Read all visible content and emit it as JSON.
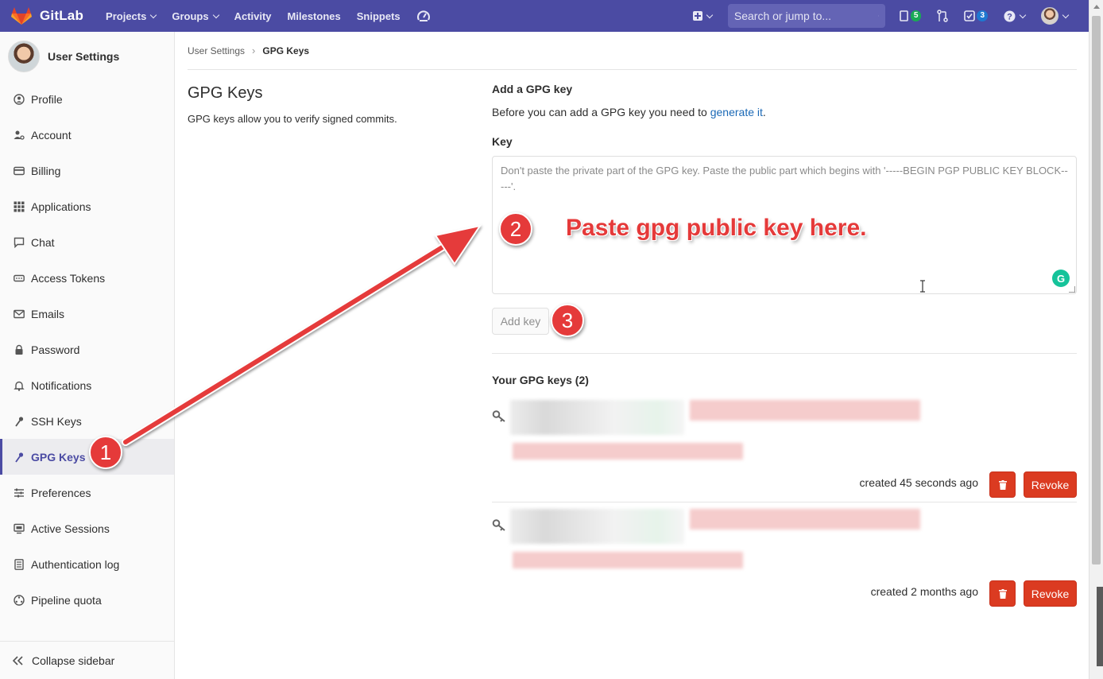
{
  "topnav": {
    "brand": "GitLab",
    "links": [
      {
        "label": "Projects",
        "dropdown": true
      },
      {
        "label": "Groups",
        "dropdown": true
      },
      {
        "label": "Activity",
        "dropdown": false
      },
      {
        "label": "Milestones",
        "dropdown": false
      },
      {
        "label": "Snippets",
        "dropdown": false
      }
    ],
    "search_placeholder": "Search or jump to...",
    "issues_count": "5",
    "todos_count": "3",
    "colors": {
      "nav_bg": "#4b4ba3",
      "issues_badge": "#1aaa55",
      "todos_badge": "#1f78d1"
    }
  },
  "sidebar": {
    "title": "User Settings",
    "items": [
      {
        "label": "Profile",
        "icon": "profile-icon"
      },
      {
        "label": "Account",
        "icon": "account-icon"
      },
      {
        "label": "Billing",
        "icon": "credit-card-icon"
      },
      {
        "label": "Applications",
        "icon": "applications-grid-icon"
      },
      {
        "label": "Chat",
        "icon": "chat-bubble-icon"
      },
      {
        "label": "Access Tokens",
        "icon": "token-icon"
      },
      {
        "label": "Emails",
        "icon": "envelope-icon"
      },
      {
        "label": "Password",
        "icon": "lock-icon"
      },
      {
        "label": "Notifications",
        "icon": "bell-icon"
      },
      {
        "label": "SSH Keys",
        "icon": "key-icon"
      },
      {
        "label": "GPG Keys",
        "icon": "key-icon",
        "active": true
      },
      {
        "label": "Preferences",
        "icon": "sliders-icon"
      },
      {
        "label": "Active Sessions",
        "icon": "monitor-icon"
      },
      {
        "label": "Authentication log",
        "icon": "log-icon"
      },
      {
        "label": "Pipeline quota",
        "icon": "quota-icon"
      }
    ],
    "collapse_label": "Collapse sidebar"
  },
  "breadcrumb": {
    "parent": "User Settings",
    "current": "GPG Keys"
  },
  "intro": {
    "title": "GPG Keys",
    "description": "GPG keys allow you to verify signed commits."
  },
  "add_form": {
    "heading": "Add a GPG key",
    "description_prefix": "Before you can add a GPG key you need to ",
    "description_link": "generate it",
    "description_suffix": ".",
    "key_label": "Key",
    "key_placeholder": "Don't paste the private part of the GPG key. Paste the public part which begins with '-----BEGIN PGP PUBLIC KEY BLOCK-----'.",
    "submit_label": "Add key"
  },
  "keys_list": {
    "heading": "Your GPG keys (2)",
    "keys": [
      {
        "created": "created 45 seconds ago",
        "revoke_label": "Revoke"
      },
      {
        "created": "created 2 months ago",
        "revoke_label": "Revoke"
      }
    ]
  },
  "annotations": {
    "step1": "1",
    "step2": "2",
    "step3": "3",
    "instruction": "Paste gpg public key here.",
    "color": "#e53a3a"
  }
}
